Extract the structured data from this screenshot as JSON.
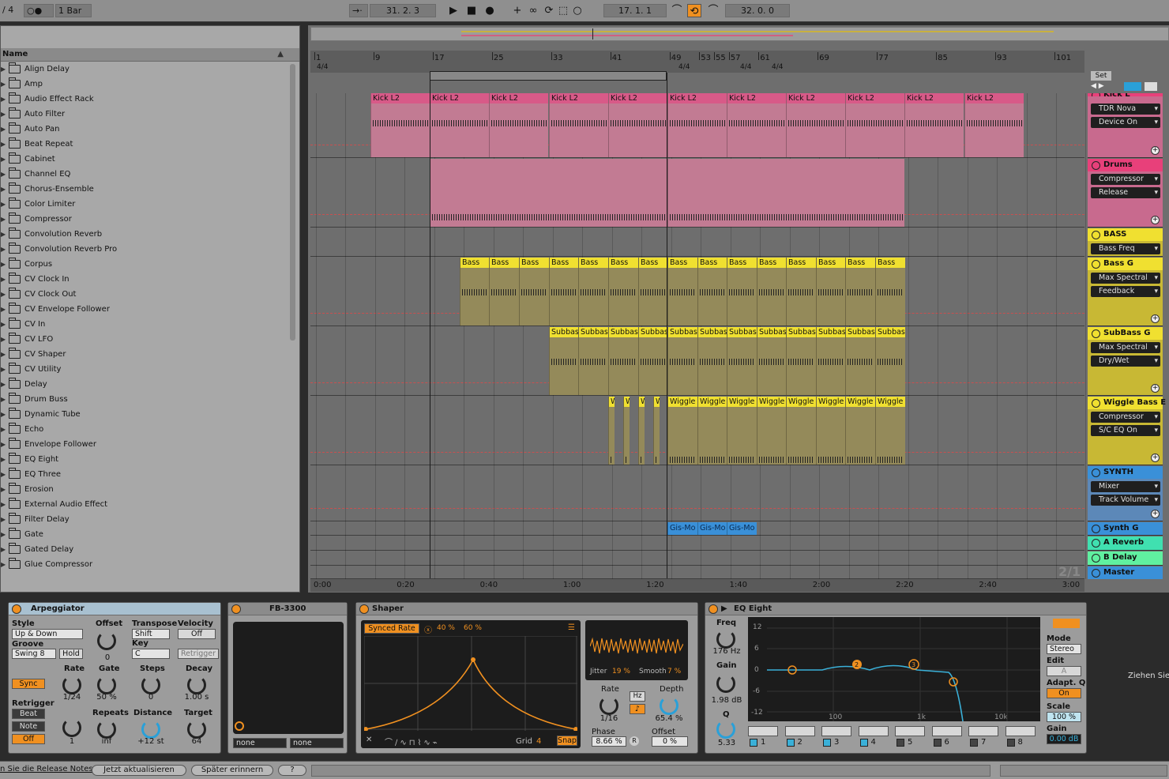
{
  "topbar": {
    "signature": "/ 4",
    "dots": "○●",
    "quantize": "1 Bar",
    "follow_symbol": "→·",
    "position": "31.  2.  3",
    "loop_start": "17.  1.  1",
    "loop_length": "32.  0.  0"
  },
  "browser": {
    "header": "Name",
    "items": [
      "Align Delay",
      "Amp",
      "Audio Effect Rack",
      "Auto Filter",
      "Auto Pan",
      "Beat Repeat",
      "Cabinet",
      "Channel EQ",
      "Chorus-Ensemble",
      "Color Limiter",
      "Compressor",
      "Convolution Reverb",
      "Convolution Reverb Pro",
      "Corpus",
      "CV Clock In",
      "CV Clock Out",
      "CV Envelope Follower",
      "CV In",
      "CV LFO",
      "CV Shaper",
      "CV Utility",
      "Delay",
      "Drum Buss",
      "Dynamic Tube",
      "Echo",
      "Envelope Follower",
      "EQ Eight",
      "EQ Three",
      "Erosion",
      "External Audio Effect",
      "Filter Delay",
      "Gate",
      "Gated Delay",
      "Glue Compressor"
    ]
  },
  "arrangement": {
    "bars": [
      "1",
      "9",
      "17",
      "25",
      "33",
      "41",
      "49",
      "53",
      "55",
      "57",
      "61",
      "69",
      "77",
      "85",
      "93",
      "101"
    ],
    "sig_labels": [
      "4/4",
      "4/4",
      "4/4",
      "4/4"
    ],
    "times": [
      "0:00",
      "0:20",
      "0:40",
      "1:00",
      "1:20",
      "1:40",
      "2:00",
      "2:20",
      "2:40",
      "3:00"
    ],
    "set_label": "Set",
    "zoom_label": "2/1",
    "kick_clip": "Kick L2",
    "bass_clip": "Bass",
    "subbass_clip": "Subbass",
    "wiggle_clip": "Wiggle",
    "wiggle_short": "W",
    "synth_clip": "Gis-Mo"
  },
  "tracks": [
    {
      "name": "Kick L",
      "color": "#e8407a",
      "controls": [
        "TDR Nova",
        "Device On"
      ]
    },
    {
      "name": "Drums",
      "color": "#e8407a",
      "controls": [
        "Compressor",
        "Release"
      ]
    },
    {
      "name": "BASS",
      "color": "#f0e030",
      "controls": [
        "Bass Freq"
      ]
    },
    {
      "name": "Bass G",
      "color": "#f0e030",
      "controls": [
        "Max Spectral",
        "Feedback"
      ]
    },
    {
      "name": "SubBass G",
      "color": "#f0e030",
      "controls": [
        "Max Spectral",
        "Dry/Wet"
      ]
    },
    {
      "name": "Wiggle Bass E",
      "color": "#f0e030",
      "controls": [
        "Compressor",
        "S/C EQ On"
      ]
    },
    {
      "name": "SYNTH",
      "color": "#3a90d8",
      "controls": [
        "Mixer",
        "Track Volume"
      ]
    },
    {
      "name": "Synth G",
      "color": "#3a90d8",
      "controls": []
    },
    {
      "name": "A Reverb",
      "color": "#40e0b0",
      "controls": []
    },
    {
      "name": "B Delay",
      "color": "#60f0a0",
      "controls": []
    },
    {
      "name": "Master",
      "color": "#3a90d8",
      "controls": []
    }
  ],
  "arpeggiator": {
    "title": "Arpeggiator",
    "style_label": "Style",
    "style_value": "Up & Down",
    "groove_label": "Groove",
    "groove_value": "Swing 8",
    "hold": "Hold",
    "offset_label": "Offset",
    "offset_value": "0",
    "transpose_label": "Transpose",
    "transpose_value": "Shift",
    "key_label": "Key",
    "key_value": "C",
    "velocity_label": "Velocity",
    "velocity_value": "Off",
    "retrigger_btn": "Retrigger",
    "sync": "Sync",
    "rate_label": "Rate",
    "rate_value": "1/24",
    "gate_label": "Gate",
    "gate_value": "50 %",
    "steps_label": "Steps",
    "steps_value": "0",
    "decay_label": "Decay",
    "decay_value": "1.00 s",
    "retrig_label": "Retrigger",
    "beat": "Beat",
    "note": "Note",
    "off": "Off",
    "one_value": "1",
    "repeats_label": "Repeats",
    "repeats_value": "inf",
    "distance_label": "Distance",
    "distance_value": "+12 st",
    "target_label": "Target",
    "target_value": "64"
  },
  "fb3300": {
    "title": "FB-3300",
    "sel1": "none",
    "sel2": "none"
  },
  "shaper": {
    "title": "Shaper",
    "synced_rate": "Synced Rate",
    "pct1": "40 %",
    "pct2": "60 %",
    "grid_label": "Grid",
    "grid_value": "4",
    "snap": "Snap",
    "jitter_label": "Jitter",
    "jitter_value": "19 %",
    "smooth_label": "Smooth",
    "smooth_value": "7 %",
    "rate_label": "Rate",
    "rate_value": "1/16",
    "hz": "Hz",
    "depth_label": "Depth",
    "depth_value": "65.4 %",
    "phase_label": "Phase",
    "phase_value": "8.66 %",
    "offset_label": "Offset",
    "offset_value": "0 %",
    "r": "R"
  },
  "eq": {
    "title": "EQ Eight",
    "freq_label": "Freq",
    "freq_value": "176 Hz",
    "gain_label": "Gain",
    "gain_value": "1.98 dB",
    "q_label": "Q",
    "q_value": "5.33",
    "db_labels": [
      "12",
      "6",
      "0",
      "-6",
      "-12"
    ],
    "hz_labels": [
      "100",
      "1k",
      "10k"
    ],
    "bands": [
      "1",
      "2",
      "3",
      "4",
      "5",
      "6",
      "7",
      "8"
    ],
    "mode_label": "Mode",
    "mode_value": "Stereo",
    "edit_label": "Edit",
    "edit_value": "A",
    "adapt_label": "Adapt. Q",
    "adapt_value": "On",
    "scale_label": "Scale",
    "scale_value": "100 %",
    "gain2_label": "Gain",
    "gain2_value": "0.00 dB"
  },
  "drop_hint": "Ziehen Sie",
  "status": {
    "release_notes": "n Sie die Release Notes",
    "update": "Jetzt aktualisieren",
    "later": "Später erinnern",
    "help": "?"
  }
}
